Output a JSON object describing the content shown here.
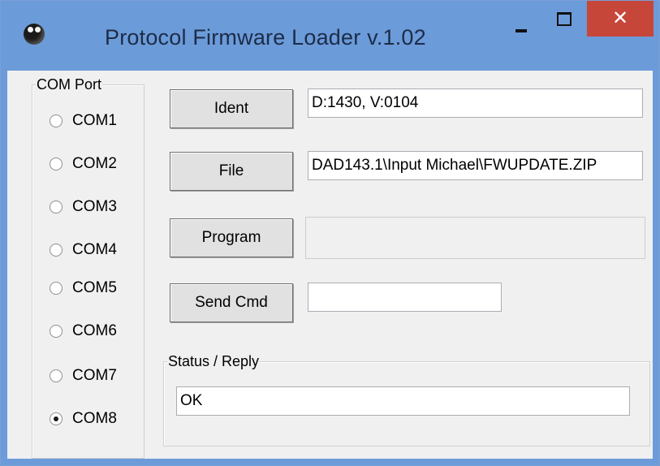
{
  "window": {
    "title": "Protocol Firmware Loader v.1.02",
    "close_glyph": "✕",
    "icon": "app-icon",
    "accent_color": "#6c9bd9",
    "close_color": "#c7463a"
  },
  "com_port": {
    "legend": "COM Port",
    "options": [
      {
        "label": "COM1",
        "checked": false
      },
      {
        "label": "COM2",
        "checked": false
      },
      {
        "label": "COM3",
        "checked": false
      },
      {
        "label": "COM4",
        "checked": false
      },
      {
        "label": "COM5",
        "checked": false
      },
      {
        "label": "COM6",
        "checked": false
      },
      {
        "label": "COM7",
        "checked": false
      },
      {
        "label": "COM8",
        "checked": true
      }
    ]
  },
  "buttons": {
    "ident": "Ident",
    "file": "File",
    "program": "Program",
    "send_cmd": "Send Cmd"
  },
  "fields": {
    "ident_value": "D:1430, V:0104",
    "file_value": "DAD143.1\\Input Michael\\FWUPDATE.ZIP",
    "program_value": "",
    "send_cmd_value": ""
  },
  "status": {
    "legend": "Status / Reply",
    "value": "OK"
  }
}
